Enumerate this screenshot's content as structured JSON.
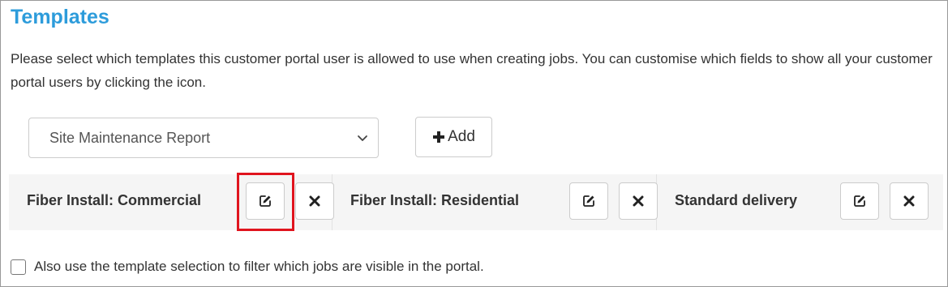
{
  "section": {
    "title": "Templates",
    "description": "Please select which templates this customer portal user is allowed to use when creating jobs. You can customise which fields to show all your customer portal users by clicking the icon."
  },
  "template_select": {
    "selected": "Site Maintenance Report",
    "icon": "chevron-down-icon"
  },
  "add_button": {
    "label": "Add",
    "icon": "plus-icon"
  },
  "templates": [
    {
      "name": "Fiber Install: Commercial",
      "edit_icon": "edit-icon",
      "remove_icon": "remove-icon"
    },
    {
      "name": "Fiber Install: Residential",
      "edit_icon": "edit-icon",
      "remove_icon": "remove-icon"
    },
    {
      "name": "Standard delivery",
      "edit_icon": "edit-icon",
      "remove_icon": "remove-icon"
    }
  ],
  "filter_option": {
    "label": "Also use the template selection to filter which jobs are visible in the portal.",
    "checked": false
  },
  "colors": {
    "title": "#2d9cdb",
    "highlight": "#e0141e",
    "row_background": "#f5f5f5"
  }
}
